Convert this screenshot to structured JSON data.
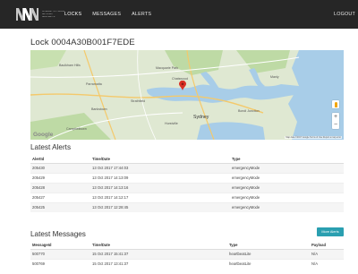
{
  "brand": {
    "line1": "INTERNET OF THINGS",
    "line2": "NETWORK",
    "line3": "NEWCASTLE"
  },
  "nav": {
    "items": [
      "LOCKS",
      "MESSAGES",
      "ALERTS"
    ],
    "active": "LOCKS",
    "logout": "LOGOUT"
  },
  "page": {
    "title": "Lock 0004A30B001F7EDE"
  },
  "map": {
    "logo": "Google",
    "attribution": "Map data ©2017 Google   Terms of Use   Report a map error",
    "zoom_in": "+",
    "zoom_out": "−",
    "labels": {
      "city": "Sydney",
      "l1": "Baulkham Hills",
      "l2": "Chatswood",
      "l3": "Parramatta",
      "l4": "Macquarie Park",
      "l5": "Strathfield",
      "l6": "Bankstown",
      "l7": "Hurstville",
      "l8": "Manly",
      "l9": "Bondi Junction",
      "l10": "Campbelltown"
    },
    "colors": {
      "land": "#dfe8d2",
      "water": "#a8cde8",
      "parks": "#bedaa5",
      "pin": "#d93025"
    }
  },
  "alerts": {
    "title": "Latest Alerts",
    "columns": [
      "AlertId",
      "Time/Date",
      "Type"
    ],
    "rows": [
      [
        "205430",
        "13 Oct 2017 17:44:03",
        "emergencyMode"
      ],
      [
        "205429",
        "13 Oct 2017 14:13:09",
        "emergencyMode"
      ],
      [
        "205428",
        "13 Oct 2017 14:13:16",
        "emergencyMode"
      ],
      [
        "205427",
        "13 Oct 2017 14:12:17",
        "emergencyMode"
      ],
      [
        "205425",
        "13 Oct 2017 12:28:45",
        "emergencyMode"
      ]
    ],
    "more_button": "More Alerts"
  },
  "messages": {
    "title": "Latest Messages",
    "columns": [
      "MessageId",
      "Time/Date",
      "Type",
      "Payload"
    ],
    "rows": [
      [
        "500770",
        "15 Oct 2017 15:41:37",
        "heartbeatLite",
        "N/A"
      ],
      [
        "500769",
        "15 Oct 2017 13:41:37",
        "heartbeatLite",
        "N/A"
      ]
    ]
  }
}
